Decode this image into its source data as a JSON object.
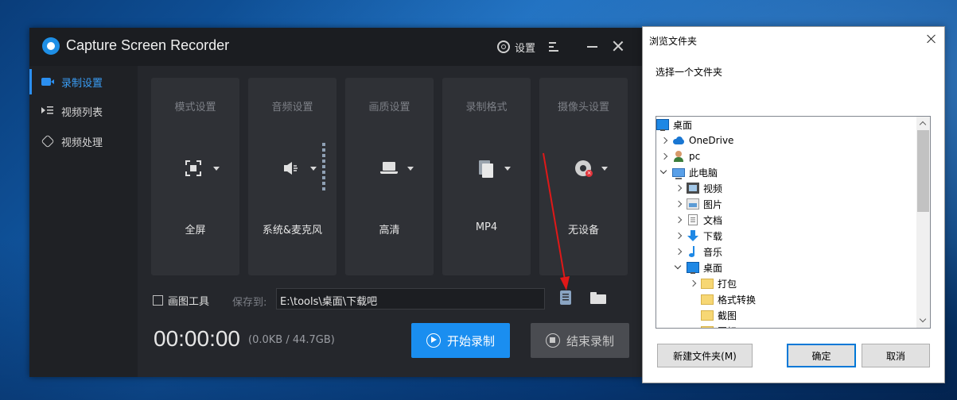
{
  "app": {
    "title": "Capture Screen Recorder",
    "settings_label": "设置"
  },
  "sidebar": {
    "items": [
      {
        "label": "录制设置",
        "icon": "camera-icon",
        "active": true
      },
      {
        "label": "视频列表",
        "icon": "list-icon",
        "active": false
      },
      {
        "label": "视频处理",
        "icon": "tools-icon",
        "active": false
      }
    ]
  },
  "cards": [
    {
      "title": "模式设置",
      "value": "全屏",
      "icon": "fullscreen-icon"
    },
    {
      "title": "音频设置",
      "value": "系统&麦克风",
      "icon": "speaker-icon"
    },
    {
      "title": "画质设置",
      "value": "高清",
      "icon": "laptop-icon"
    },
    {
      "title": "录制格式",
      "value": "MP4",
      "icon": "file-icon"
    },
    {
      "title": "摄像头设置",
      "value": "无设备",
      "icon": "webcam-icon"
    }
  ],
  "bottom": {
    "draw_tools_label": "画图工具",
    "save_to_label": "保存到:",
    "save_path": "E:\\tools\\桌面\\下载吧",
    "timer": "00:00:00",
    "size_text": "(0.0KB / 44.7GB)",
    "start_label": "开始录制",
    "stop_label": "结束录制"
  },
  "dialog": {
    "title": "浏览文件夹",
    "prompt": "选择一个文件夹",
    "tree": [
      {
        "label": "桌面",
        "icon": "desktop-icon",
        "expander": "none",
        "indent": 0
      },
      {
        "label": "OneDrive",
        "icon": "cloud-icon",
        "expander": "collapsed",
        "indent": 1
      },
      {
        "label": "pc",
        "icon": "user-icon",
        "expander": "collapsed",
        "indent": 1
      },
      {
        "label": "此电脑",
        "icon": "pc-icon",
        "expander": "expanded",
        "indent": 1
      },
      {
        "label": "视频",
        "icon": "video-folder-icon",
        "expander": "collapsed",
        "indent": 2
      },
      {
        "label": "图片",
        "icon": "picture-folder-icon",
        "expander": "collapsed",
        "indent": 2
      },
      {
        "label": "文档",
        "icon": "document-folder-icon",
        "expander": "collapsed",
        "indent": 2
      },
      {
        "label": "下载",
        "icon": "download-folder-icon",
        "expander": "collapsed",
        "indent": 2
      },
      {
        "label": "音乐",
        "icon": "music-folder-icon",
        "expander": "collapsed",
        "indent": 2
      },
      {
        "label": "桌面",
        "icon": "desktop-icon",
        "expander": "expanded",
        "indent": 2
      },
      {
        "label": "打包",
        "icon": "folder-icon",
        "expander": "collapsed",
        "indent": 3
      },
      {
        "label": "格式转换",
        "icon": "folder-icon",
        "expander": "none",
        "indent": 3
      },
      {
        "label": "截图",
        "icon": "folder-icon",
        "expander": "none",
        "indent": 3
      },
      {
        "label": "图标",
        "icon": "folder-icon",
        "expander": "none",
        "indent": 3
      }
    ],
    "new_folder_label": "新建文件夹(M)",
    "ok_label": "确定",
    "cancel_label": "取消"
  },
  "colors": {
    "accent": "#1a8ef0",
    "annotation_arrow": "#e01818",
    "app_bg": "#25272c"
  }
}
